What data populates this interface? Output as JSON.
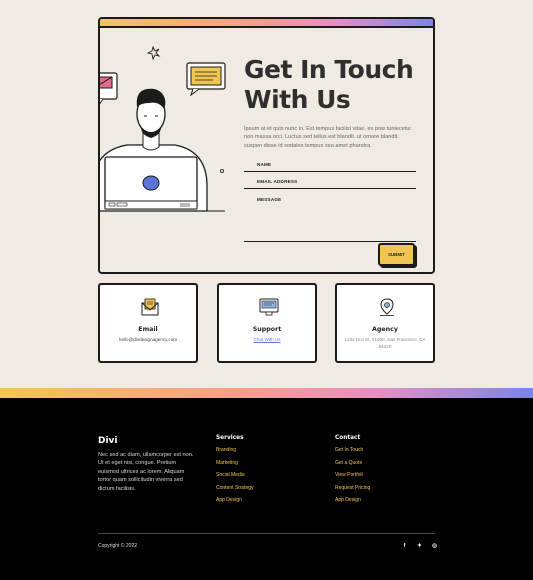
{
  "contact": {
    "heading": "Get In Touch With Us",
    "description": "Ipsum at et quis nunc in. Est tempus facilisi vitae, ex pow tuniecetur non massa orci. Luctus sed tellus est blandit. ut ornare blandit. suspen disse id sodales tempus sea amet pharetra.",
    "fields": {
      "name_label": "NAME",
      "email_label": "EMAIL ADDRESS",
      "message_label": "MESSAGE"
    },
    "submit_label": "SUBMIT"
  },
  "cards": [
    {
      "title": "Email",
      "text": "hello@divdesignagency.com",
      "icon": "envelope-icon"
    },
    {
      "title": "Support",
      "text": "Chat With Us",
      "icon": "monitor-chat-icon"
    },
    {
      "title": "Agency",
      "text": "1234 Divi St. #1000, San Francisco, CA 94220",
      "icon": "location-pin-icon"
    }
  ],
  "footer": {
    "brand": "Divi",
    "brand_text": "Nec sed ac diam, ullamcorper est non. Ut et eget nisi, congue. Pretium euismod ultrices ac lorem. Aliquam tortor quam sollicitudin viverra sed dictum facilisis.",
    "services": {
      "heading": "Services",
      "links": [
        "Branding",
        "Marketing",
        "Social Media",
        "Content Strategy",
        "App Design"
      ]
    },
    "contact": {
      "heading": "Contact",
      "links": [
        "Get In Touch",
        "Get a Quote",
        "View Portfoli",
        "Request Pricing",
        "App Design"
      ]
    },
    "copyright": "Copyright © 2022",
    "socials": [
      {
        "name": "facebook-icon",
        "glyph": "f"
      },
      {
        "name": "twitter-icon",
        "glyph": "✦"
      },
      {
        "name": "instagram-icon",
        "glyph": "◎"
      }
    ]
  },
  "colors": {
    "background": "#efebe3",
    "accent_yellow": "#f1c551",
    "accent_pink": "#e98fc2",
    "accent_blue": "#7a86e6",
    "link_blue": "#5b74d8",
    "footer_bg": "#000000"
  }
}
